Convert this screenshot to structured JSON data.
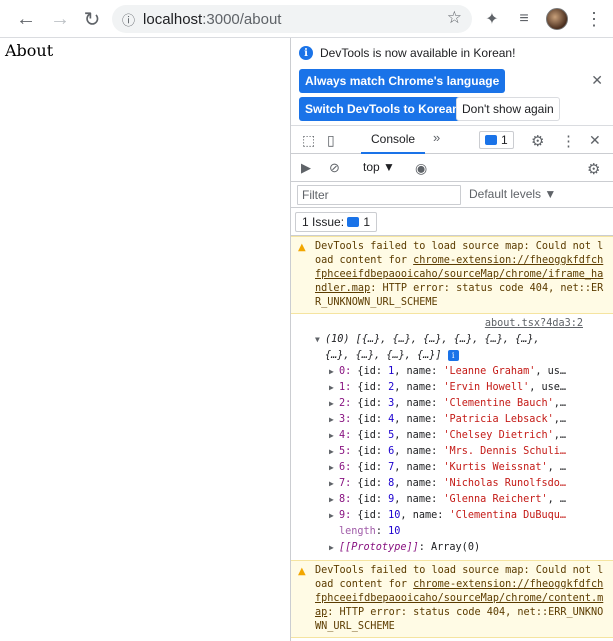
{
  "browser": {
    "url_host": "localhost",
    "url_rest": ":3000/about"
  },
  "page": {
    "heading": "About"
  },
  "infobar": {
    "message": "DevTools is now available in Korean!",
    "btn_match": "Always match Chrome's language",
    "btn_switch": "Switch DevTools to Korean",
    "btn_dont": "Don't show again"
  },
  "tabs": {
    "console": "Console",
    "more": "»",
    "issues_count": "1"
  },
  "consolebar": {
    "context": "top ▼"
  },
  "filter": {
    "placeholder": "Filter",
    "levels": "Default levels ▼"
  },
  "issues": {
    "label": "1 Issue:",
    "count": "1"
  },
  "warn1": {
    "prefix": "DevTools failed to load source map: Could not load content for ",
    "link": "chrome-extension://fheoggkfdfchfphceeifdbepaooicaho/sourceMap/chrome/iframe_handler.map",
    "suffix": ": HTTP error: status code 404, net::ERR_UNKNOWN_URL_SCHEME"
  },
  "log": {
    "source": "about.tsx?4da3:2",
    "summary_line1": "(10) [{…}, {…}, {…}, {…}, {…}, {…},",
    "summary_line2": "{…}, {…}, {…}, {…}]",
    "items": [
      {
        "idx": "0:",
        "id": "1",
        "name": "'Leanne Graham'",
        "tail": ", us…"
      },
      {
        "idx": "1:",
        "id": "2",
        "name": "'Ervin Howell'",
        "tail": ", use…"
      },
      {
        "idx": "2:",
        "id": "3",
        "name": "'Clementine Bauch'",
        "tail": ",…"
      },
      {
        "idx": "3:",
        "id": "4",
        "name": "'Patricia Lebsack'",
        "tail": ",…"
      },
      {
        "idx": "4:",
        "id": "5",
        "name": "'Chelsey Dietrich'",
        "tail": ",…"
      },
      {
        "idx": "5:",
        "id": "6",
        "name": "'Mrs. Dennis Schuli…",
        "tail": ""
      },
      {
        "idx": "6:",
        "id": "7",
        "name": "'Kurtis Weissnat'",
        "tail": ", …"
      },
      {
        "idx": "7:",
        "id": "8",
        "name": "'Nicholas Runolfsdo…",
        "tail": ""
      },
      {
        "idx": "8:",
        "id": "9",
        "name": "'Glenna Reichert'",
        "tail": ", …"
      },
      {
        "idx": "9:",
        "id": "10",
        "name": "'Clementina DuBuqu…",
        "tail": ""
      }
    ],
    "length_key": "length",
    "length_val": "10",
    "proto_key": "[[Prototype]]",
    "proto_val": "Array(0)"
  },
  "warn2": {
    "prefix": "DevTools failed to load source map: Could not load content for ",
    "link": "chrome-extension://fheoggkfdfchfphceeifdbepaooicaho/sourceMap/chrome/content.map",
    "suffix": ": HTTP error: status code 404, net::ERR_UNKNOWN_URL_SCHEME"
  }
}
